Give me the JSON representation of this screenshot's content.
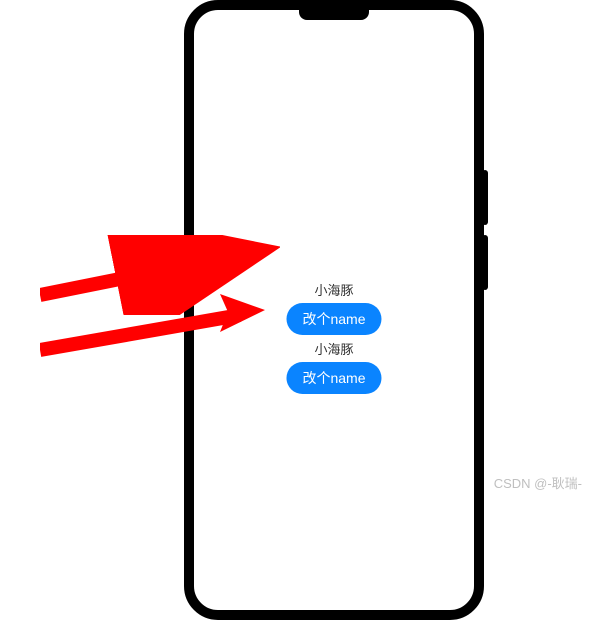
{
  "content": {
    "group1": {
      "label": "小海豚",
      "button": "改个name"
    },
    "group2": {
      "label": "小海豚",
      "button": "改个name"
    }
  },
  "watermark": "CSDN @-耿瑞-",
  "colors": {
    "button_bg": "#0A84FF",
    "arrow": "#FF0000"
  }
}
